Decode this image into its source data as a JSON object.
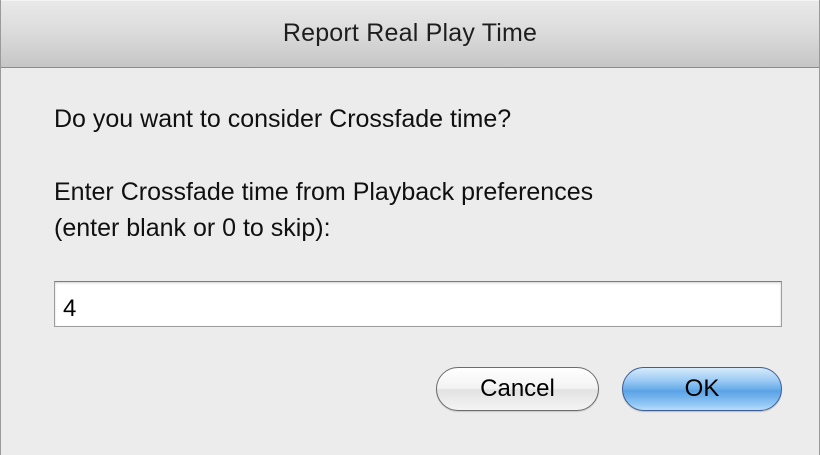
{
  "window": {
    "title": "Report Real Play Time"
  },
  "dialog": {
    "question": "Do you want to consider Crossfade time?",
    "prompt_line1": "Enter Crossfade time from Playback preferences",
    "prompt_line2": "(enter blank or 0 to skip):",
    "input_value": "4"
  },
  "buttons": {
    "cancel_label": "Cancel",
    "ok_label": "OK"
  },
  "colors": {
    "background": "#ececec",
    "default_button": "#5aa2e6"
  }
}
